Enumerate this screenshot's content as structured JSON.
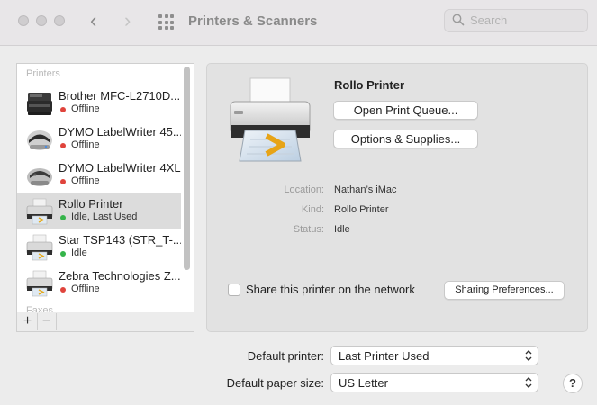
{
  "window": {
    "title": "Printers & Scanners"
  },
  "search": {
    "placeholder": "Search"
  },
  "sidebar": {
    "section_printers": "Printers",
    "section_faxes": "Faxes",
    "printers": [
      {
        "name": "Brother MFC-L2710D...",
        "status": "Offline",
        "status_color": "#e0443c"
      },
      {
        "name": "DYMO LabelWriter 45...",
        "status": "Offline",
        "status_color": "#e0443c"
      },
      {
        "name": "DYMO LabelWriter 4XL",
        "status": "Offline",
        "status_color": "#e0443c"
      },
      {
        "name": "Rollo Printer",
        "status": "Idle, Last Used",
        "status_color": "#35b44a"
      },
      {
        "name": "Star TSP143 (STR_T-...",
        "status": "Idle",
        "status_color": "#35b44a"
      },
      {
        "name": "Zebra Technologies Z...",
        "status": "Offline",
        "status_color": "#e0443c"
      }
    ],
    "add_label": "+",
    "remove_label": "−"
  },
  "detail": {
    "printer_name": "Rollo Printer",
    "open_queue_label": "Open Print Queue...",
    "options_label": "Options & Supplies...",
    "location_label": "Location:",
    "location_value": "Nathan’s iMac",
    "kind_label": "Kind:",
    "kind_value": "Rollo Printer",
    "status_label": "Status:",
    "status_value": "Idle",
    "share_label": "Share this printer on the network",
    "share_checked": false,
    "sharing_prefs_label": "Sharing Preferences..."
  },
  "defaults": {
    "printer_label": "Default printer:",
    "printer_value": "Last Printer Used",
    "paper_label": "Default paper size:",
    "paper_value": "US Letter"
  },
  "help_label": "?"
}
